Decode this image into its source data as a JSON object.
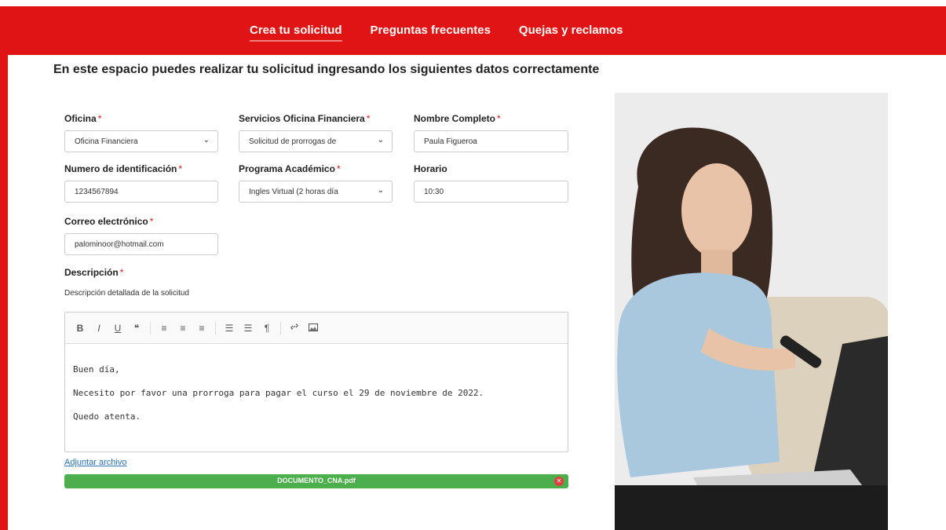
{
  "nav": {
    "items": [
      {
        "label": "Crea tu solicitud",
        "active": true
      },
      {
        "label": "Preguntas frecuentes",
        "active": false
      },
      {
        "label": "Quejas y reclamos",
        "active": false
      }
    ]
  },
  "intro": "En este espacio puedes realizar tu solicitud ingresando los siguientes datos correctamente",
  "form": {
    "oficina": {
      "label": "Oficina",
      "value": "Oficina Financiera"
    },
    "servicios": {
      "label": "Servicios Oficina Financiera",
      "value": "Solicitud de prorrogas de"
    },
    "nombre": {
      "label": "Nombre Completo",
      "value": "Paula Figueroa"
    },
    "identificacion": {
      "label": "Numero de identificación",
      "value": "1234567894"
    },
    "programa": {
      "label": "Programa Académico",
      "value": "Ingles Virtual (2 horas día"
    },
    "horario": {
      "label": "Horario",
      "value": "10:30"
    },
    "correo": {
      "label": "Correo electrónico",
      "value": "palominoor@hotmail.com"
    },
    "descripcion": {
      "label": "Descripción",
      "hint": "Descripción detallada de la solicitud",
      "lines": [
        "Buen día,",
        "Necesito por favor una prorroga para pagar el curso el 29 de noviembre de 2022.",
        "Quedo atenta."
      ]
    },
    "required_mark": "*",
    "attach_label": "Adjuntar archivo",
    "file_name": "DOCUMENTO_CNA.pdf"
  },
  "toolbar": {
    "bold": "B",
    "italic": "I",
    "underline": "U",
    "quote": "❝",
    "align_left": "≡",
    "align_center": "≡",
    "align_right": "≡",
    "ul": "☰",
    "ol": "☰",
    "paragraph": "¶",
    "link": "🔗",
    "image": "▣"
  },
  "colors": {
    "brand": "#e01414",
    "success": "#4cae4c",
    "link": "#2a6fb0"
  },
  "icons": {
    "select": "chevron-down-icon",
    "remove": "close-icon"
  }
}
